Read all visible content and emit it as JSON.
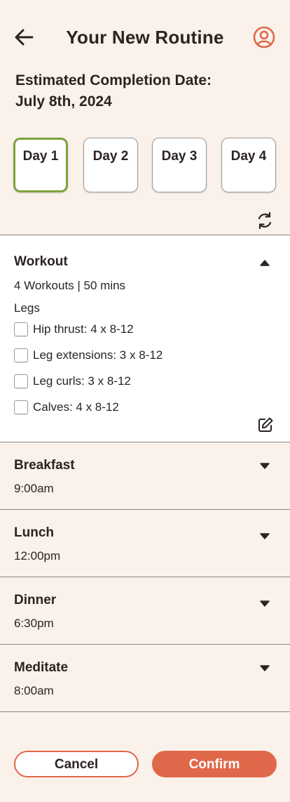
{
  "header": {
    "title": "Your New Routine"
  },
  "estimate": {
    "line1": "Estimated Completion Date:",
    "line2": "July 8th, 2024"
  },
  "days": [
    {
      "label": "Day 1",
      "selected": true
    },
    {
      "label": "Day 2",
      "selected": false
    },
    {
      "label": "Day 3",
      "selected": false
    },
    {
      "label": "Day 4",
      "selected": false
    }
  ],
  "workout": {
    "title": "Workout",
    "summary": "4 Workouts | 50 mins",
    "group": "Legs",
    "exercises": [
      {
        "label": "Hip thrust: 4 x 8-12",
        "checked": false
      },
      {
        "label": "Leg extensions: 3 x 8-12",
        "checked": false
      },
      {
        "label": "Leg curls: 3 x 8-12",
        "checked": false
      },
      {
        "label": "Calves: 4 x 8-12",
        "checked": false
      }
    ]
  },
  "sections": [
    {
      "title": "Breakfast",
      "time": "9:00am"
    },
    {
      "title": "Lunch",
      "time": "12:00pm"
    },
    {
      "title": "Dinner",
      "time": "6:30pm"
    },
    {
      "title": "Meditate",
      "time": "8:00am"
    }
  ],
  "actions": {
    "cancel": "Cancel",
    "confirm": "Confirm"
  },
  "colors": {
    "accent": "#e0684a",
    "selected_border": "#7ea23c",
    "background": "#f9f1ea"
  }
}
